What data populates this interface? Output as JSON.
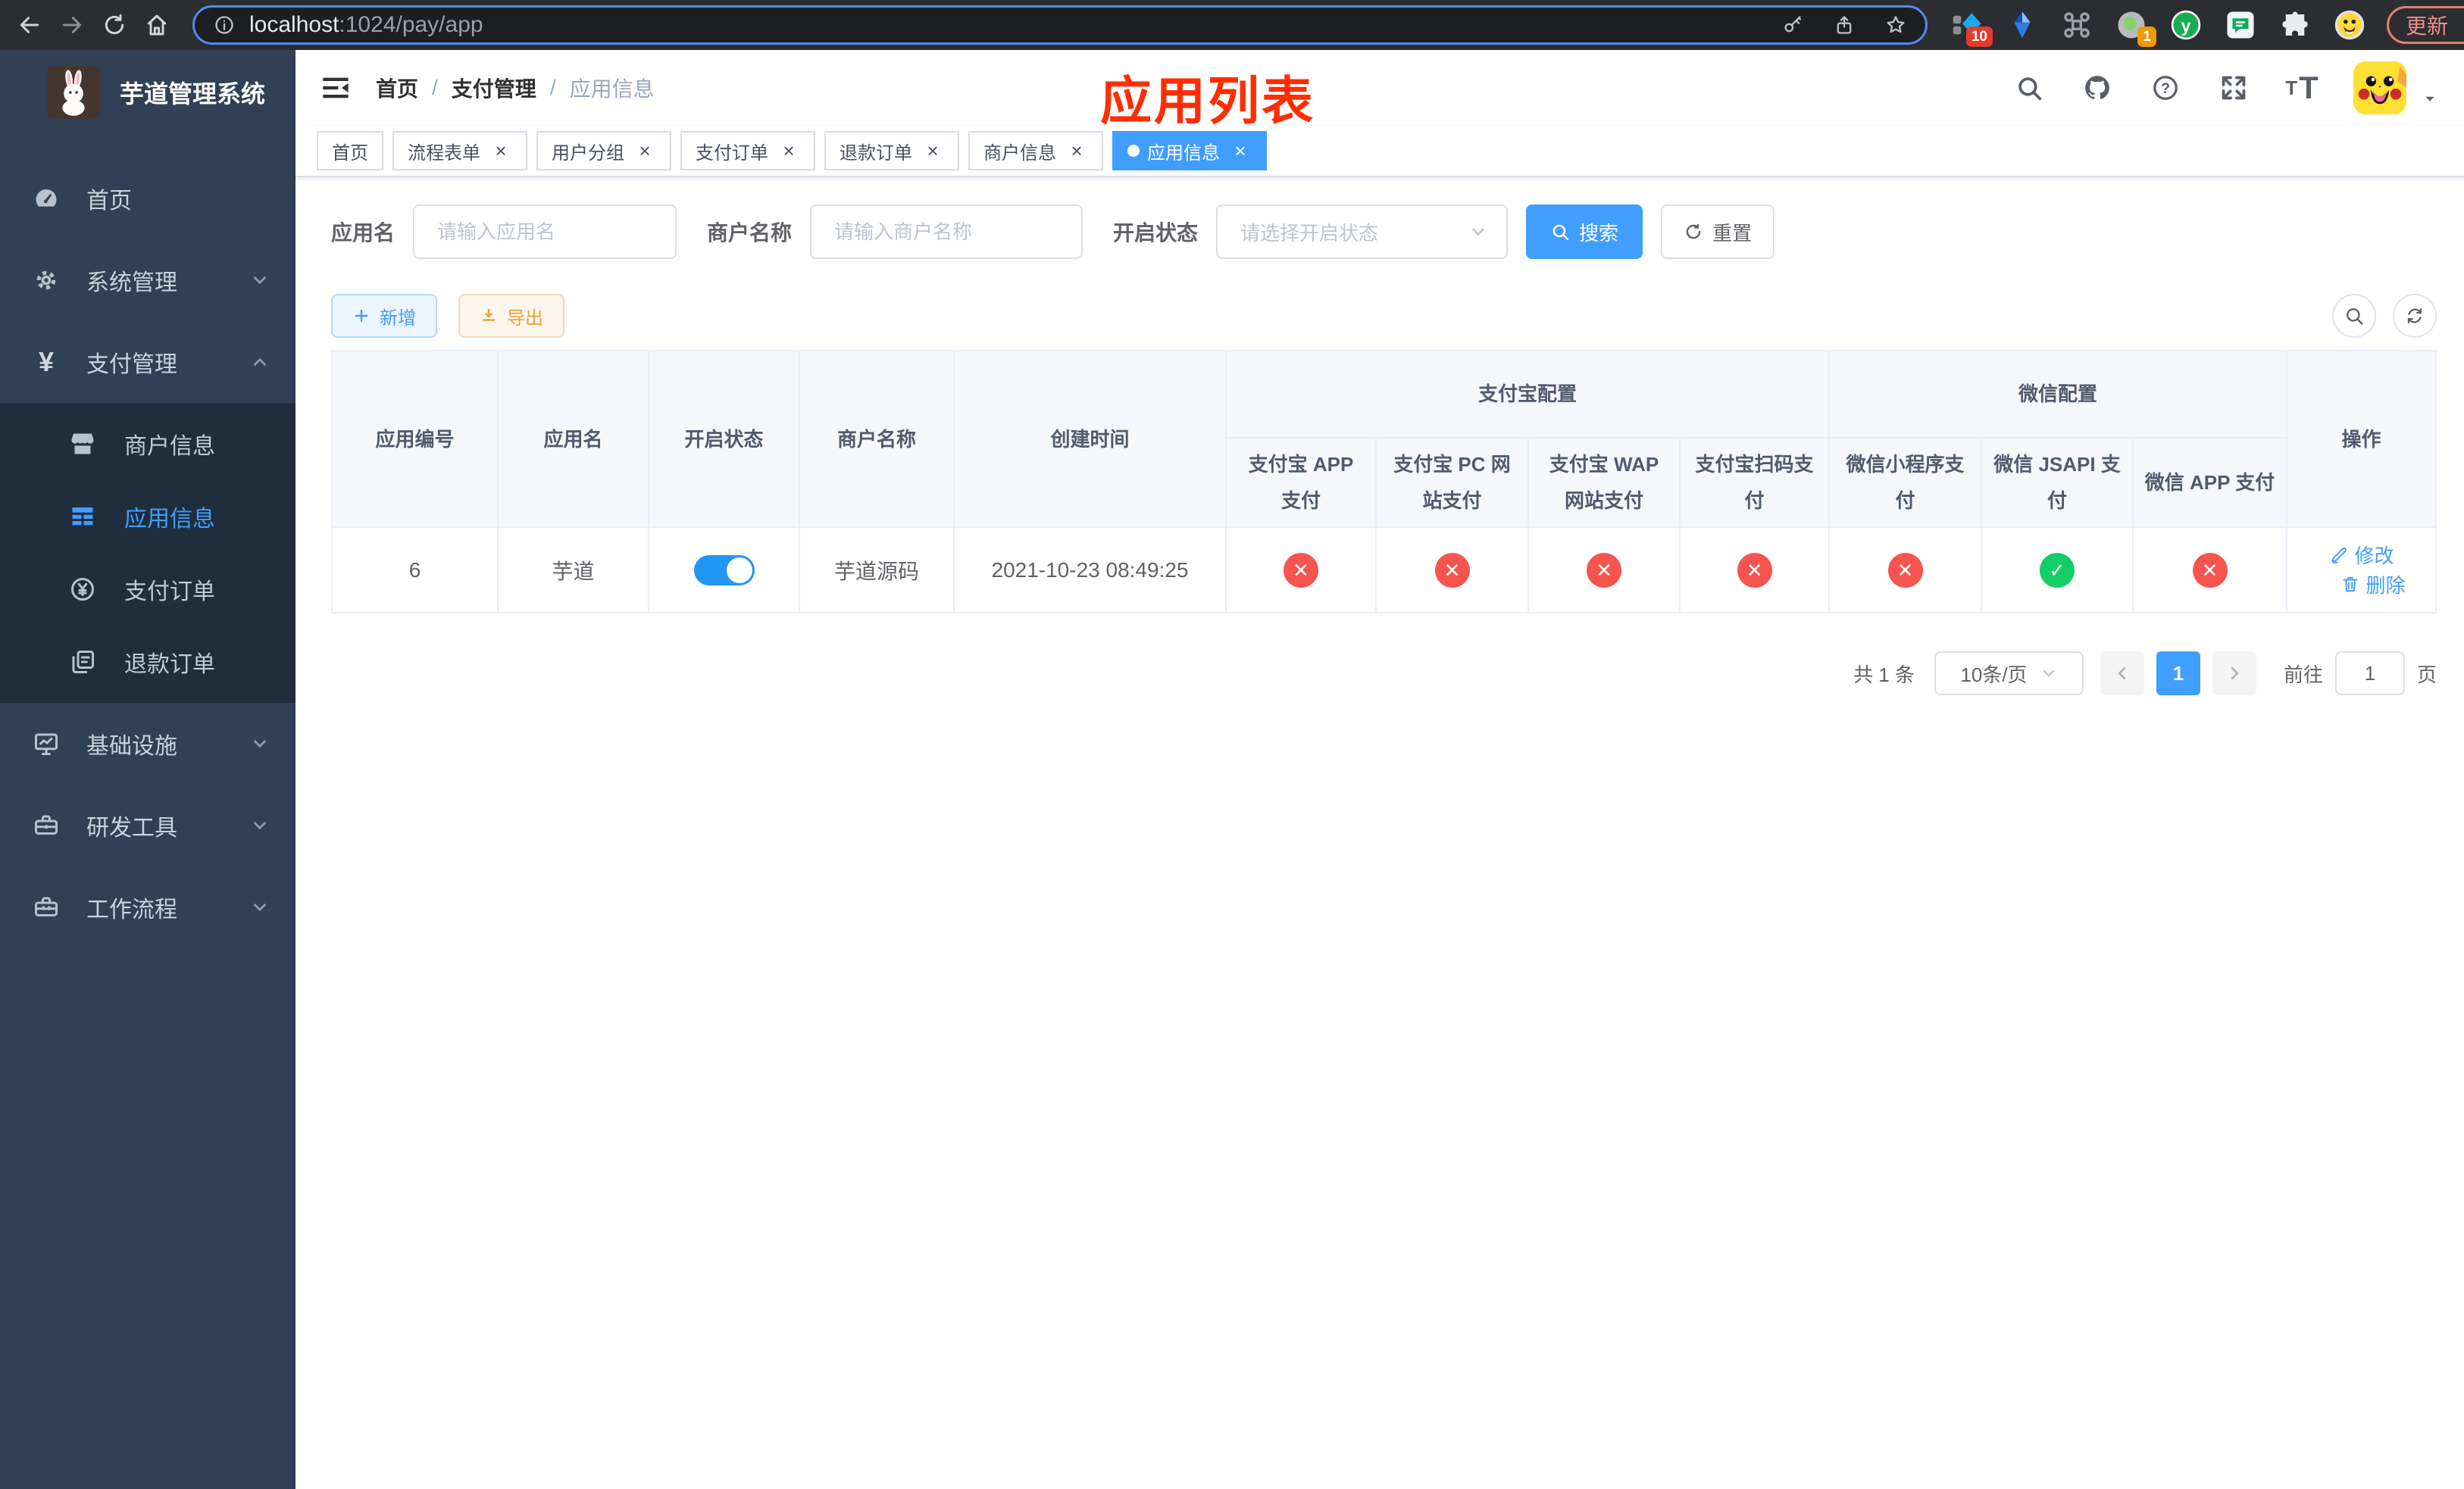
{
  "browser": {
    "url_host": "localhost",
    "url_path": ":1024/pay/app",
    "update_label": "更新",
    "ext_badge_10": "10",
    "ext_badge_1": "1",
    "ext_y": "y"
  },
  "ui": {
    "close_glyph": "×",
    "yen_glyph": "¥",
    "question_glyph": "?",
    "font_glyph_small": "T",
    "font_glyph_big": "T"
  },
  "sidebar": {
    "title": "芋道管理系统",
    "menu": [
      {
        "label": "首页"
      },
      {
        "label": "系统管理"
      },
      {
        "label": "支付管理"
      },
      {
        "label": "基础设施"
      },
      {
        "label": "研发工具"
      },
      {
        "label": "工作流程"
      }
    ],
    "submenu": [
      {
        "label": "商户信息"
      },
      {
        "label": "应用信息"
      },
      {
        "label": "支付订单"
      },
      {
        "label": "退款订单"
      }
    ]
  },
  "navbar": {
    "breadcrumb": [
      "首页",
      "支付管理",
      "应用信息"
    ],
    "separator": "/"
  },
  "annotation": {
    "text": "应用列表",
    "color": "#ff2d00"
  },
  "tabs": [
    {
      "label": "首页"
    },
    {
      "label": "流程表单"
    },
    {
      "label": "用户分组"
    },
    {
      "label": "支付订单"
    },
    {
      "label": "退款订单"
    },
    {
      "label": "商户信息"
    },
    {
      "label": "应用信息"
    }
  ],
  "filters": {
    "app_name": {
      "label": "应用名",
      "placeholder": "请输入应用名"
    },
    "merchant": {
      "label": "商户名称",
      "placeholder": "请输入商户名称"
    },
    "status": {
      "label": "开启状态",
      "placeholder": "请选择开启状态"
    },
    "search": "搜索",
    "reset": "重置"
  },
  "toolbar": {
    "add": "新增",
    "export": "导出"
  },
  "table": {
    "columns": {
      "app_id": "应用编号",
      "app_name": "应用名",
      "status": "开启状态",
      "merchant": "商户名称",
      "created": "创建时间",
      "alipay_group": "支付宝配置",
      "wechat_group": "微信配置",
      "alipay_app": "支付宝 APP 支付",
      "alipay_pc": "支付宝 PC 网站支付",
      "alipay_wap": "支付宝 WAP 网站支付",
      "alipay_qr": "支付宝扫码支付",
      "wx_lite": "微信小程序支付",
      "wx_jsapi": "微信 JSAPI 支付",
      "wx_app": "微信 APP 支付",
      "actions": "操作"
    },
    "status_glyphs": {
      "enabled": "✓",
      "disabled": "✕"
    },
    "row": {
      "app_id": "6",
      "app_name": "芋道",
      "merchant": "芋道源码",
      "created": "2021-10-23 08:49:25",
      "configs": {
        "alipay_app": "disabled",
        "alipay_pc": "disabled",
        "alipay_wap": "disabled",
        "alipay_qr": "disabled",
        "wx_lite": "disabled",
        "wx_jsapi": "enabled",
        "wx_app": "disabled"
      },
      "edit": "修改",
      "delete": "删除"
    }
  },
  "pagination": {
    "total": "共 1 条",
    "page_size": "10条/页",
    "page": "1",
    "goto_label": "前往",
    "goto_value": "1",
    "page_suffix": "页"
  }
}
